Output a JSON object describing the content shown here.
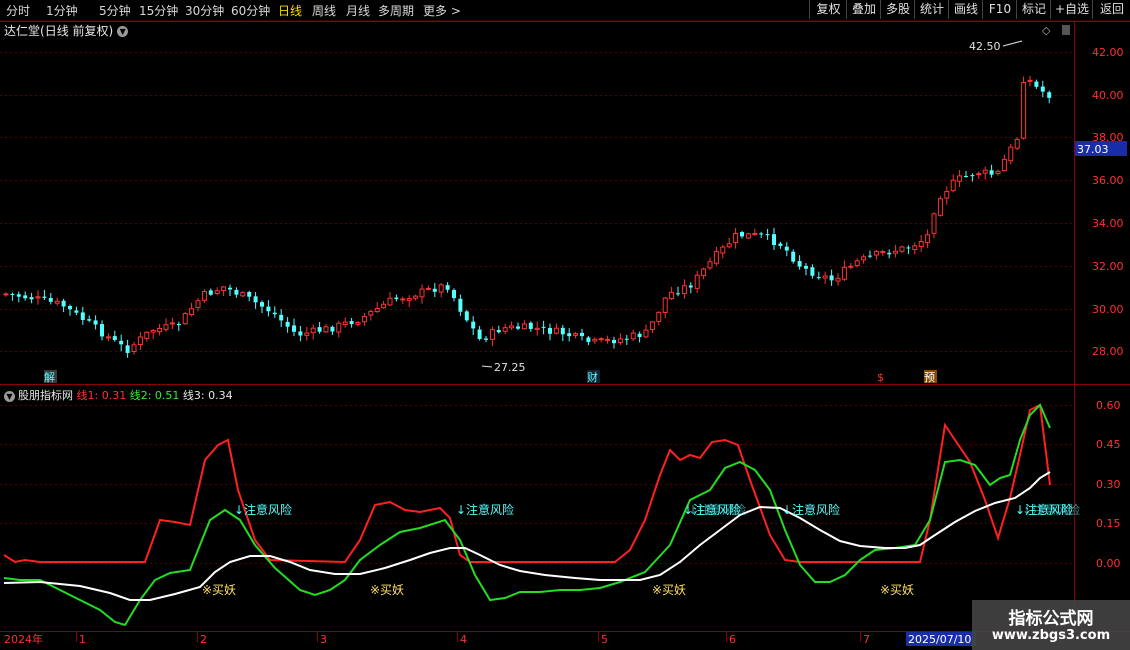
{
  "toolbar": {
    "periods": [
      "分时",
      "1分钟",
      "5分钟",
      "15分钟",
      "30分钟",
      "60分钟",
      "日线",
      "周线",
      "月线",
      "多周期",
      "更多 >"
    ],
    "active_period": "日线",
    "buttons": [
      "复权",
      "叠加",
      "多股",
      "统计",
      "画线",
      "F10",
      "标记",
      "+自选",
      "返回"
    ]
  },
  "main_chart": {
    "stock_name": "达仁堂",
    "mode": "(日线 前复权)",
    "price_axis": [
      "42.00",
      "40.00",
      "38.00",
      "36.00",
      "34.00",
      "32.00",
      "30.00",
      "28.00"
    ],
    "current_price": "37.03",
    "high_label": "42.50",
    "low_label": "27.25",
    "markers": [
      "解",
      "财",
      "$",
      "预"
    ],
    "colors": {
      "up": "#ff3232",
      "down": "#54ffff"
    }
  },
  "indicator": {
    "name": "股朋指标网",
    "line1_label": "线1: 0.31",
    "line2_label": "线2: 0.51",
    "line3_label": "线3: 0.34",
    "axis": [
      "0.60",
      "0.45",
      "0.30",
      "0.15",
      "0.00"
    ],
    "signal_buy": "※买妖",
    "signal_risk": "↓注意风险",
    "colors": {
      "line1": "#ff2020",
      "line2": "#22dd22",
      "line3": "#ffffff"
    }
  },
  "date_axis": [
    "2024年",
    "1",
    "2",
    "3",
    "4",
    "5",
    "6",
    "7"
  ],
  "cursor_date": "2025/07/10",
  "watermark": {
    "title": "指标公式网",
    "url": "www.zbgs3.com"
  }
}
